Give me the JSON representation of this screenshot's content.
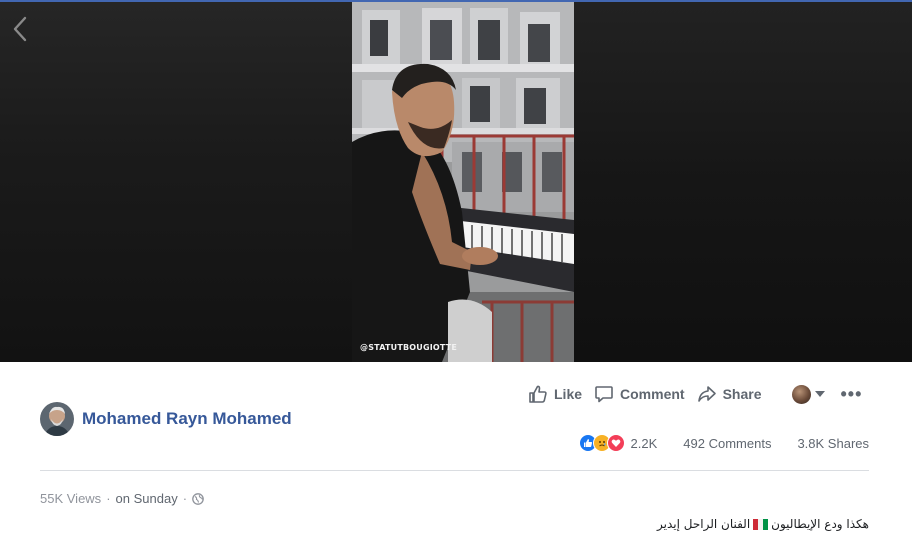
{
  "video": {
    "watermark": "@STATUTBOUGIOTTE"
  },
  "actions": {
    "like_label": "Like",
    "comment_label": "Comment",
    "share_label": "Share"
  },
  "author": {
    "name": "Mohamed Rayn Mohamed"
  },
  "stats": {
    "reaction_count": "2.2K",
    "comments": "492 Comments",
    "shares": "3.8K Shares"
  },
  "meta": {
    "views": "55K Views",
    "separator": "·",
    "date": "on Sunday",
    "separator2": "·"
  },
  "caption": {
    "text_before_flag": "هكذا ودع الإيطاليون",
    "text_after_flag": "الفنان الراحل إيدير"
  },
  "colors": {
    "brand_blue": "#4267b2",
    "link_blue": "#365899",
    "muted_text": "#606770",
    "like_blue": "#1877f2",
    "love_red": "#f33e58",
    "sad_yellow": "#f7b125"
  }
}
